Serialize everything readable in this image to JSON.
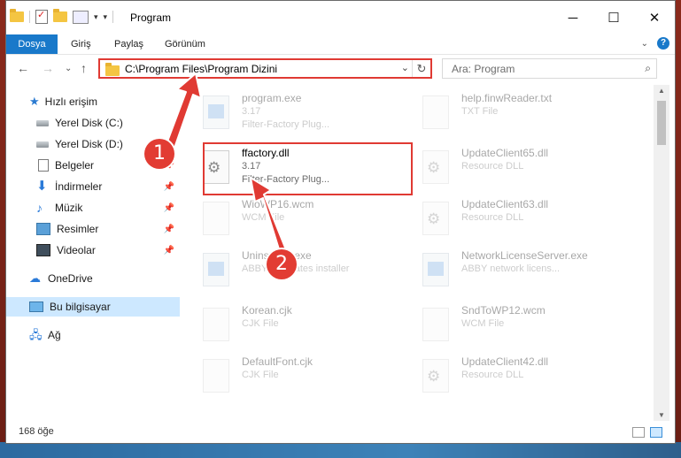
{
  "window": {
    "title": "Program"
  },
  "ribbon": {
    "tabs": [
      "Dosya",
      "Giriş",
      "Paylaş",
      "Görünüm"
    ],
    "help": "?"
  },
  "nav": {
    "address": "C:\\Program Files\\Program Dizini",
    "search_placeholder": "Ara: Program"
  },
  "sidebar": {
    "items": [
      {
        "label": "Hızlı erişim",
        "icon": "star-icon"
      },
      {
        "label": "Yerel Disk (C:)",
        "icon": "disk-icon"
      },
      {
        "label": "Yerel Disk (D:)",
        "icon": "disk-icon"
      },
      {
        "label": "Belgeler",
        "icon": "documents-icon"
      },
      {
        "label": "İndirmeler",
        "icon": "download-icon"
      },
      {
        "label": "Müzik",
        "icon": "music-icon"
      },
      {
        "label": "Resimler",
        "icon": "pictures-icon"
      },
      {
        "label": "Videolar",
        "icon": "videos-icon"
      },
      {
        "label": "OneDrive",
        "icon": "cloud-icon"
      },
      {
        "label": "Bu bilgisayar",
        "icon": "computer-icon"
      },
      {
        "label": "Ağ",
        "icon": "network-icon"
      }
    ]
  },
  "files": [
    {
      "name": "program.exe",
      "line2": "3.17",
      "line3": "Filter-Factory Plug...",
      "kind": "app"
    },
    {
      "name": "help.finwReader.txt",
      "line2": "TXT File",
      "line3": "",
      "kind": "doc"
    },
    {
      "name": "ffactory.dll",
      "line2": "3.17",
      "line3": "Filter-Factory Plug...",
      "kind": "dll"
    },
    {
      "name": "UpdateClient65.dll",
      "line2": "Resource DLL",
      "line3": "",
      "kind": "dll"
    },
    {
      "name": "WioWP16.wcm",
      "line2": "WCM File",
      "line3": "",
      "kind": "doc"
    },
    {
      "name": "UpdateClient63.dll",
      "line2": "Resource DLL",
      "line3": "",
      "kind": "dll"
    },
    {
      "name": "Uninstaller.exe",
      "line2": "ABBYY Updates installer",
      "line3": "",
      "kind": "app"
    },
    {
      "name": "NetworkLicenseServer.exe",
      "line2": "ABBY network licens...",
      "line3": "",
      "kind": "app"
    },
    {
      "name": "Korean.cjk",
      "line2": "CJK File",
      "line3": "",
      "kind": "doc"
    },
    {
      "name": "SndToWP12.wcm",
      "line2": "WCM File",
      "line3": "",
      "kind": "doc"
    },
    {
      "name": "DefaultFont.cjk",
      "line2": "CJK File",
      "line3": "",
      "kind": "doc"
    },
    {
      "name": "UpdateClient42.dll",
      "line2": "Resource DLL",
      "line3": "",
      "kind": "dll"
    }
  ],
  "status": {
    "count": "168 öğe"
  },
  "annotations": {
    "step1": "1",
    "step2": "2",
    "color": "#e03a33"
  }
}
